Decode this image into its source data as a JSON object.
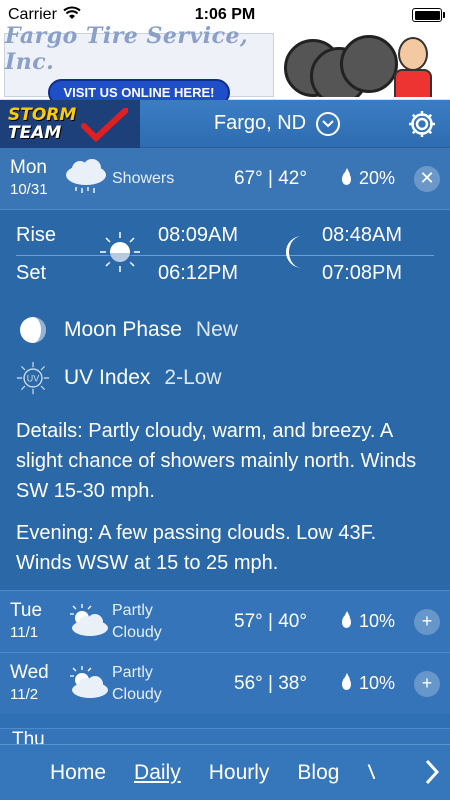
{
  "status_bar": {
    "carrier": "Carrier",
    "time": "1:06 PM"
  },
  "ad": {
    "title": "Fargo Tire Service, Inc.",
    "cta": "VISIT US ONLINE HERE!"
  },
  "header": {
    "logo_top": "STORM",
    "logo_bottom": "TEAM",
    "location": "Fargo, ND"
  },
  "today": {
    "day": "Mon",
    "date": "10/31",
    "condition": "Showers",
    "temps": "67° | 42°",
    "precip": "20%",
    "button": "✕"
  },
  "sun_moon": {
    "rise_label": "Rise",
    "set_label": "Set",
    "sunrise": "08:09AM",
    "sunset": "06:12PM",
    "moonrise": "08:48AM",
    "moonset": "07:08PM"
  },
  "moon_phase": {
    "label": "Moon Phase",
    "value": "New"
  },
  "uv_index": {
    "label": "UV Index",
    "value": "2-Low",
    "icon_text": "UV"
  },
  "details": "Details: Partly cloudy, warm, and breezy. A slight chance of showers mainly north. Winds SW 15-30 mph.",
  "evening": "Evening: A few passing clouds. Low 43F. Winds WSW at 15 to 25 mph.",
  "forecast": [
    {
      "day": "Tue",
      "date": "11/1",
      "condition_1": "Partly",
      "condition_2": "Cloudy",
      "temps": "57° | 40°",
      "precip": "10%",
      "button": "+"
    },
    {
      "day": "Wed",
      "date": "11/2",
      "condition_1": "Partly",
      "condition_2": "Cloudy",
      "temps": "56° | 38°",
      "precip": "10%",
      "button": "+"
    },
    {
      "day": "Thu",
      "date": "",
      "condition_1": "",
      "condition_2": "",
      "temps": "",
      "precip": "",
      "button": ""
    }
  ],
  "nav": {
    "home": "Home",
    "daily": "Daily",
    "hourly": "Hourly",
    "blog": "Blog",
    "more": "V"
  },
  "colors": {
    "background": "#2f6fb3",
    "logo_yellow": "#ffcc00",
    "cta_blue": "#1e4fc9"
  }
}
